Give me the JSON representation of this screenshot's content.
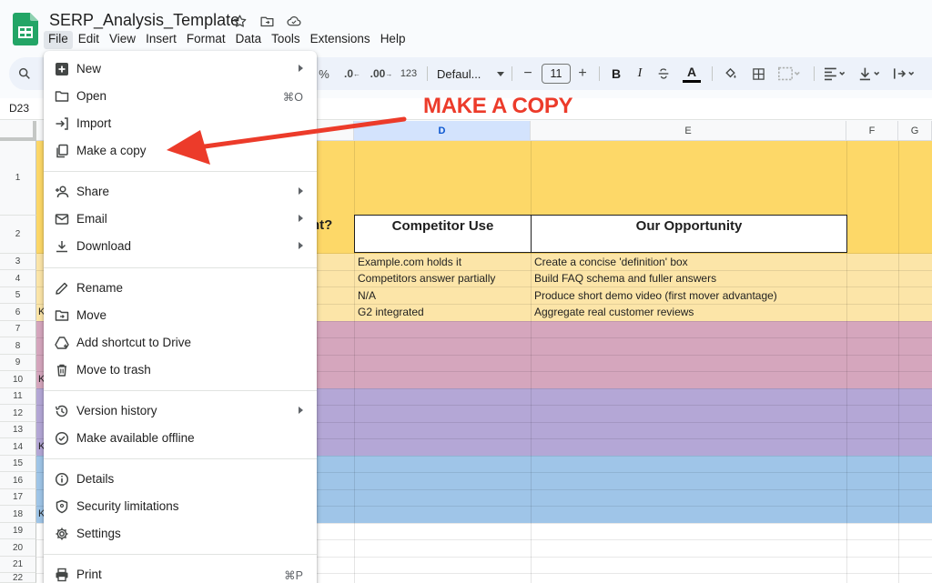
{
  "app": {
    "title": "SERP_Analysis_Template",
    "menu_bar": [
      "File",
      "Edit",
      "View",
      "Insert",
      "Format",
      "Data",
      "Tools",
      "Extensions",
      "Help"
    ],
    "active_menu": "File"
  },
  "toolbar": {
    "percent": "%",
    "decimal_decrease": ".0",
    "decimal_increase": ".00",
    "number_format": "123",
    "font_family": "Defaul...",
    "font_size": "11"
  },
  "formula_bar": {
    "name_box": "D23"
  },
  "grid": {
    "columns": [
      "D",
      "E",
      "F",
      "G"
    ],
    "selected_column": "D",
    "rows": [
      "1",
      "2",
      "3",
      "4",
      "5",
      "6",
      "7",
      "8",
      "9",
      "10",
      "11",
      "12",
      "13",
      "14",
      "15",
      "16",
      "17",
      "18",
      "19",
      "20",
      "21",
      "22"
    ],
    "header_fragment": "nt?",
    "headers": {
      "competitor_use": "Competitor Use",
      "our_opportunity": "Our Opportunity"
    },
    "data_rows": [
      {
        "competitor_use": "Example.com holds it",
        "our_opportunity": "Create a concise 'definition' box"
      },
      {
        "competitor_use": "Competitors answer partially",
        "our_opportunity": "Build FAQ schema and fuller answers"
      },
      {
        "competitor_use": "N/A",
        "our_opportunity": "Produce short demo video (first mover advantage)"
      },
      {
        "competitor_use": "G2 integrated",
        "our_opportunity": "Aggregate real customer reviews"
      }
    ],
    "fragment_k": "K",
    "band_colors": {
      "yellow": "#fdd868",
      "yellow_light": "#fce5a8",
      "pink": "#d5a6bd",
      "purple": "#b4a7d6",
      "blue": "#9fc5e8"
    }
  },
  "file_menu": {
    "items": [
      {
        "label": "New",
        "icon": "new-doc-icon",
        "submenu": true
      },
      {
        "label": "Open",
        "icon": "folder-open-icon",
        "shortcut": "⌘O"
      },
      {
        "label": "Import",
        "icon": "import-icon"
      },
      {
        "label": "Make a copy",
        "icon": "copy-icon"
      },
      {
        "label": "Share",
        "icon": "share-person-icon",
        "submenu": true
      },
      {
        "label": "Email",
        "icon": "email-icon",
        "submenu": true
      },
      {
        "label": "Download",
        "icon": "download-icon",
        "submenu": true
      },
      {
        "label": "Rename",
        "icon": "pencil-icon"
      },
      {
        "label": "Move",
        "icon": "move-folder-icon"
      },
      {
        "label": "Add shortcut to Drive",
        "icon": "drive-shortcut-icon"
      },
      {
        "label": "Move to trash",
        "icon": "trash-icon"
      },
      {
        "label": "Version history",
        "icon": "history-icon",
        "submenu": true
      },
      {
        "label": "Make available offline",
        "icon": "offline-icon"
      },
      {
        "label": "Details",
        "icon": "info-icon"
      },
      {
        "label": "Security limitations",
        "icon": "shield-icon"
      },
      {
        "label": "Settings",
        "icon": "gear-icon"
      },
      {
        "label": "Print",
        "icon": "print-icon",
        "shortcut": "⌘P"
      }
    ]
  },
  "annotation": {
    "text": "MAKE A COPY",
    "color": "#ec3b2a"
  }
}
